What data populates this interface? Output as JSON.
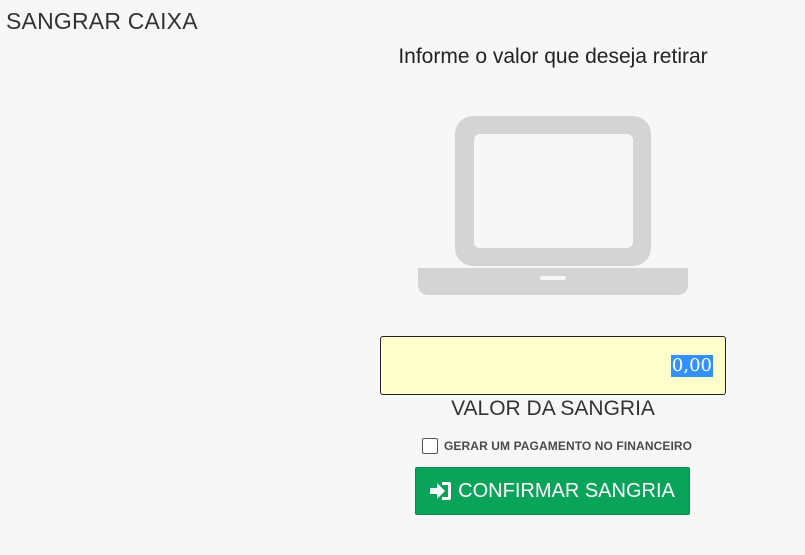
{
  "page": {
    "title": "SANGRAR CAIXA"
  },
  "panel": {
    "prompt": "Informe o valor que deseja retirar",
    "illustration_icon": "laptop-icon",
    "amount": {
      "value": "0,00",
      "label": "VALOR DA SANGRIA"
    },
    "finance_option": {
      "label": "GERAR UM PAGAMENTO NO FINANCEIRO",
      "checked": false
    },
    "confirm_button": {
      "label": "CONFIRMAR SANGRIA",
      "icon": "sign-in-icon"
    }
  },
  "colors": {
    "background": "#f7f7f7",
    "input_background": "#ffffcc",
    "selection": "#3390ff",
    "button": "#0aa35a",
    "icon_gray": "#d4d4d4"
  }
}
